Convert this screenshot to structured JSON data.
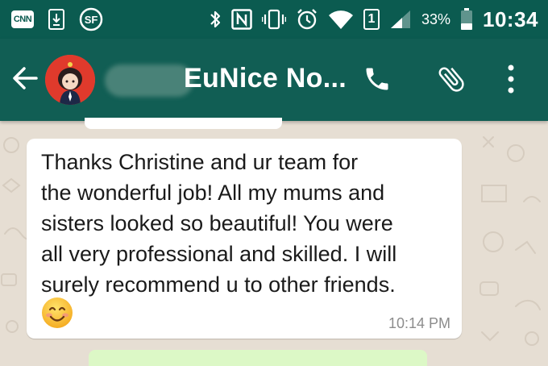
{
  "status_bar": {
    "cnn_label": "CNN",
    "sim_label": "1",
    "battery_pct": "33%",
    "time": "10:34",
    "icons": [
      "cnn-icon",
      "download-icon",
      "sf-icon",
      "bluetooth-icon",
      "nfc-icon",
      "vibrate-icon",
      "alarm-icon",
      "wifi-icon",
      "sim-icon",
      "signal-icon",
      "battery-icon"
    ]
  },
  "header": {
    "contact_name": "EuNice No...",
    "icons": [
      "back-arrow-icon",
      "avatar",
      "phone-icon",
      "paperclip-icon",
      "overflow-menu-icon"
    ]
  },
  "message": {
    "lines": [
      "Thanks Christine and ur team for",
      "the wonderful job! All my mums and",
      "sisters looked so beautiful! You were",
      "all very professional and skilled. I will",
      "surely recommend u to other friends."
    ],
    "emoji": "smiling-face-icon",
    "time": "10:14 PM"
  },
  "colors": {
    "status_bar": "#0b5b50",
    "app_bar": "#115e54",
    "wallpaper": "#e6ded3",
    "bubble": "#ffffff",
    "timestamp": "#8c8c8c"
  }
}
